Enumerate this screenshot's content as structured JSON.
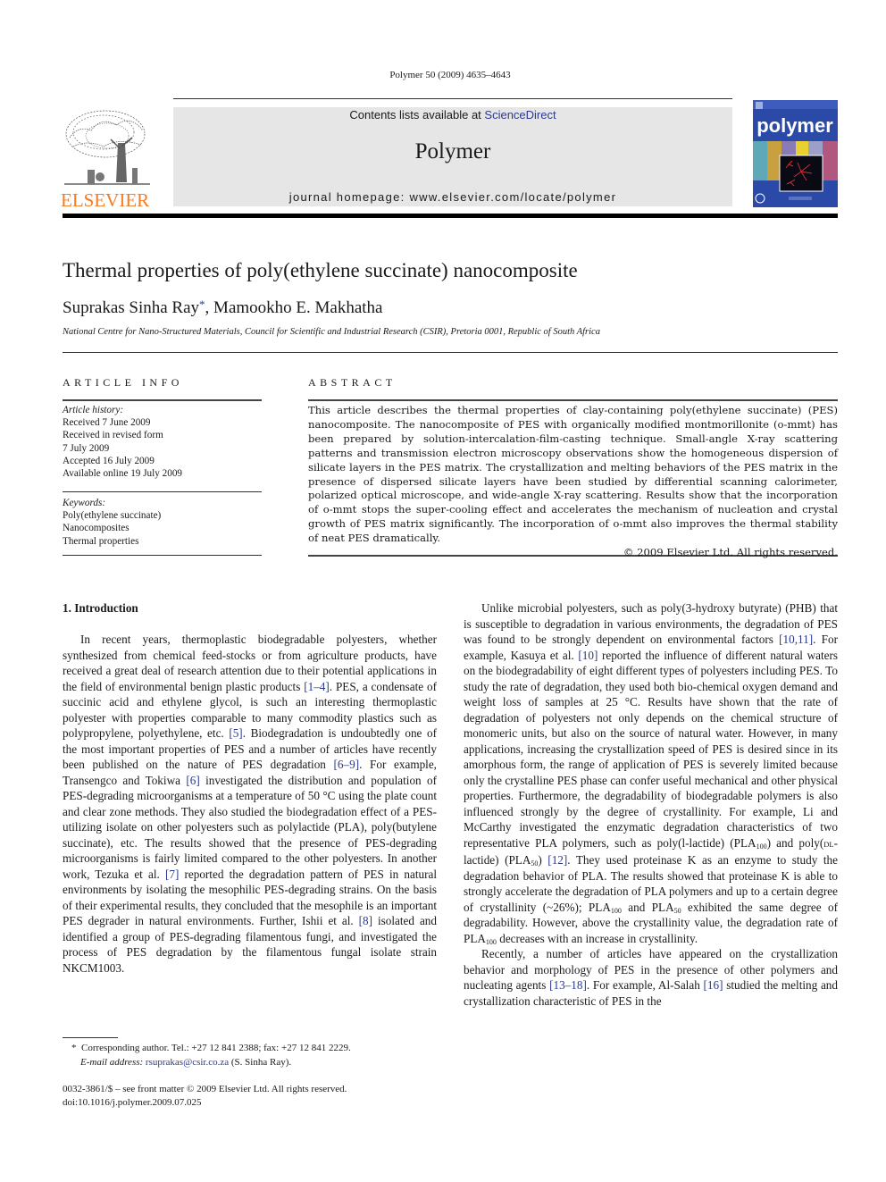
{
  "running_head": "Polymer 50 (2009) 4635–4643",
  "header": {
    "publisher_logo_text": "ELSEVIER",
    "contents_prefix": "Contents lists available at ",
    "contents_link": "ScienceDirect",
    "journal_name": "Polymer",
    "homepage_line": "journal homepage: www.elsevier.com/locate/polymer",
    "cover_title": "polymer",
    "colors": {
      "logo_orange": "#f47b20",
      "cover_blue": "#2b4aa8",
      "banner_gray": "#e6e6e6",
      "link_blue": "#2b3a8f"
    }
  },
  "article": {
    "title": "Thermal properties of poly(ethylene succinate) nanocomposite",
    "authors": [
      {
        "name": "Suprakas Sinha Ray",
        "mark": "*"
      },
      {
        "name": "Mamookho E. Makhatha",
        "mark": ""
      }
    ],
    "author_separator": ", ",
    "affiliation": "National Centre for Nano-Structured Materials, Council for Scientific and Industrial Research (CSIR), Pretoria 0001, Republic of South Africa"
  },
  "article_info": {
    "heading": "ARTICLE INFO",
    "history_label": "Article history:",
    "history": [
      "Received 7 June 2009",
      "Received in revised form",
      "7 July 2009",
      "Accepted 16 July 2009",
      "Available online 19 July 2009"
    ],
    "keywords_label": "Keywords:",
    "keywords": [
      "Poly(ethylene succinate)",
      "Nanocomposites",
      "Thermal properties"
    ]
  },
  "abstract": {
    "heading": "ABSTRACT",
    "text": "This article describes the thermal properties of clay-containing poly(ethylene succinate) (PES) nanocomposite. The nanocomposite of PES with organically modified montmorillonite (o-mmt) has been prepared by solution-intercalation-film-casting technique. Small-angle X-ray scattering patterns and transmission electron microscopy observations show the homogeneous dispersion of silicate layers in the PES matrix. The crystallization and melting behaviors of the PES matrix in the presence of dispersed silicate layers have been studied by differential scanning calorimeter, polarized optical microscope, and wide-angle X-ray scattering. Results show that the incorporation of o-mmt stops the super-cooling effect and accelerates the mechanism of nucleation and crystal growth of PES matrix significantly. The incorporation of o-mmt also improves the thermal stability of neat PES dramatically.",
    "copyright": "© 2009 Elsevier Ltd. All rights reserved."
  },
  "introduction": {
    "heading": "1.  Introduction",
    "p1": [
      {
        "t": "In recent years, thermoplastic biodegradable polyesters, whether synthesized from chemical feed-stocks or from agriculture products, have received a great deal of research attention due to their potential applications in the field of environmental benign plastic products "
      },
      {
        "ref": "[1–4]"
      },
      {
        "t": ". PES, a condensate of succinic acid and ethylene glycol, is such an interesting thermoplastic polyester with properties comparable to many commodity plastics such as polypropylene, polyethylene, etc. "
      },
      {
        "ref": "[5]"
      },
      {
        "t": ". Biodegradation is undoubtedly one of the most important properties of PES and a number of articles have recently been published on the nature of PES degradation "
      },
      {
        "ref": "[6–9]"
      },
      {
        "t": ". For example, Transengco and Tokiwa "
      },
      {
        "ref": "[6]"
      },
      {
        "t": " investigated the distribution and population of PES-degrading microorganisms at a temperature of 50 °C using the plate count and clear zone methods. They also studied the biodegradation effect of a PES-utilizing isolate on other polyesters such as polylactide (PLA), poly(butylene succinate), etc. The results showed that the presence of PES-degrading microorganisms is fairly limited compared to the other polyesters. In another work, Tezuka et al. "
      },
      {
        "ref": "[7]"
      },
      {
        "t": " reported the degradation pattern of PES in natural environments by isolating the mesophilic PES-degrading strains. On the basis of their experimental results, they concluded that the mesophile is an important PES degrader in natural environments. Further, Ishii et al. "
      },
      {
        "ref": "[8]"
      },
      {
        "t": " isolated and identified a group of PES-degrading filamentous fungi, and investigated the process of PES degradation by the filamentous fungal isolate strain NKCM1003."
      }
    ],
    "p2": [
      {
        "t": "Unlike microbial polyesters, such as poly(3-hydroxy butyrate) (PHB) that is susceptible to degradation in various environments, the degradation of PES was found to be strongly dependent on environmental factors "
      },
      {
        "ref": "[10,11]"
      },
      {
        "t": ". For example, Kasuya et al. "
      },
      {
        "ref": "[10]"
      },
      {
        "t": " reported the influence of different natural waters on the biodegradability of eight different types of polyesters including PES. To study the rate of degradation, they used both bio-chemical oxygen demand and weight loss of samples at 25 °C. Results have shown that the rate of degradation of polyesters not only depends on the chemical structure of monomeric units, but also on the source of natural water. However, in many applications, increasing the crystallization speed of PES is desired since in its amorphous form, the range of application of PES is severely limited because only the crystalline PES phase can confer useful mechanical and other physical properties. Furthermore, the degradability of biodegradable polymers is also influenced strongly by the degree of crystallinity. For example, Li and McCarthy investigated the enzymatic degradation characteristics of two representative PLA polymers, such as poly(l-lactide) (PLA"
      },
      {
        "sub": "100"
      },
      {
        "t": ") and poly("
      },
      {
        "sc": "DL"
      },
      {
        "t": "-lactide) (PLA"
      },
      {
        "sub": "50"
      },
      {
        "t": ") "
      },
      {
        "ref": "[12]"
      },
      {
        "t": ". They used proteinase K as an enzyme to study the degradation behavior of PLA. The results showed that proteinase K is able to strongly accelerate the degradation of PLA polymers and up to a certain degree of crystallinity (~26%); PLA"
      },
      {
        "sub": "100"
      },
      {
        "t": " and PLA"
      },
      {
        "sub": "50"
      },
      {
        "t": " exhibited the same degree of degradability. However, above the crystallinity value, the degradation rate of PLA"
      },
      {
        "sub": "100"
      },
      {
        "t": " decreases with an increase in crystallinity."
      }
    ],
    "p3": [
      {
        "t": "Recently, a number of articles have appeared on the crystallization behavior and morphology of PES in the presence of other polymers and nucleating agents "
      },
      {
        "ref": "[13–18]"
      },
      {
        "t": ". For example, Al-Salah "
      },
      {
        "ref": "[16]"
      },
      {
        "t": " studied the melting and crystallization characteristic of PES in the"
      }
    ]
  },
  "footnote": {
    "mark": "*",
    "corresponding": "Corresponding author. Tel.: +27 12 841 2388; fax: +27 12 841 2229.",
    "email_label": "E-mail address:",
    "email": "rsuprakas@csir.co.za",
    "email_suffix": " (S. Sinha Ray)."
  },
  "front_matter": {
    "issn_line": "0032-3861/$ – see front matter © 2009 Elsevier Ltd. All rights reserved.",
    "doi": "doi:10.1016/j.polymer.2009.07.025"
  }
}
